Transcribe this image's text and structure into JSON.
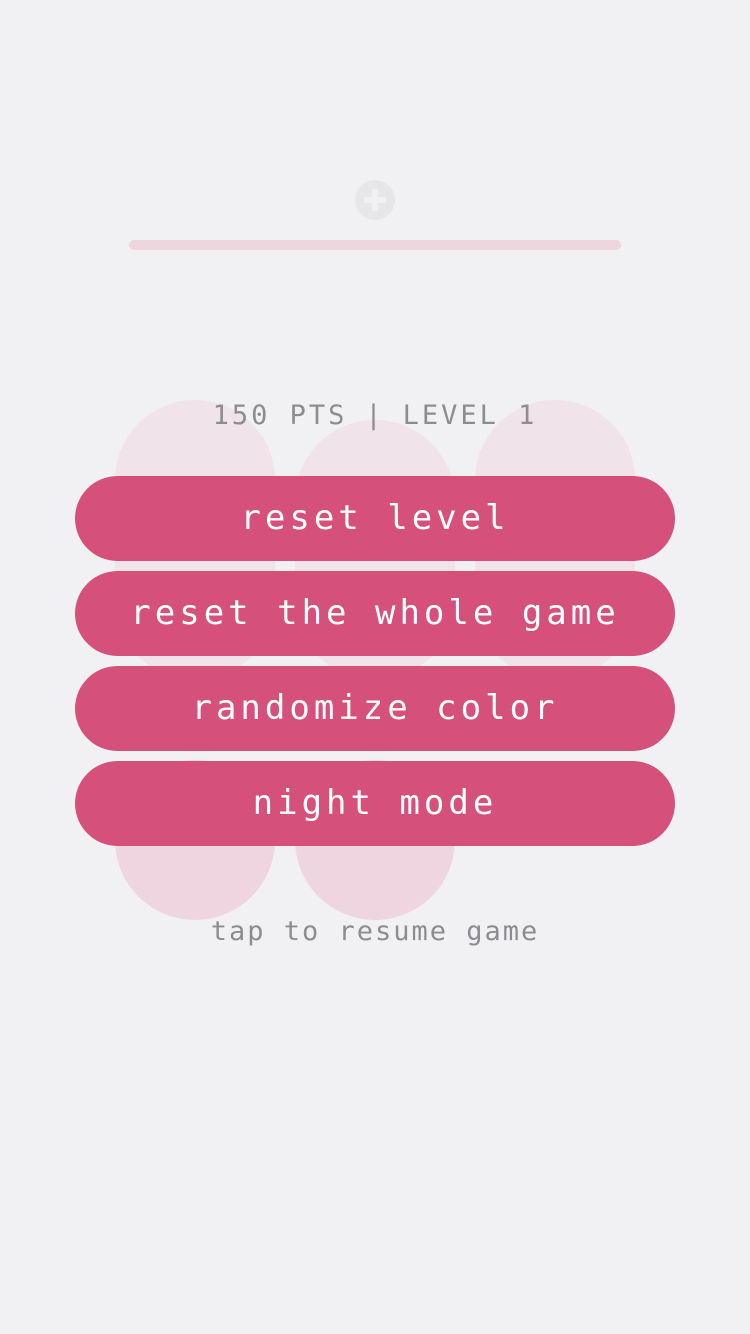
{
  "header": {
    "icon": "plus-circle-icon",
    "progress_fraction": 1.0
  },
  "score": {
    "points": "150 PTS",
    "separator": "|",
    "level": "LEVEL 1"
  },
  "menu": {
    "reset_level": "reset level",
    "reset_game": "reset the whole game",
    "randomize_color": "randomize color",
    "night_mode": "night mode"
  },
  "hint": "tap to resume game",
  "colors": {
    "background": "#f1f0f2",
    "button": "#d5517c",
    "button_text": "#ffffff",
    "muted_text": "#8e8c91",
    "pill_light": "#f0e3ea",
    "pill_dark": "#efd5df"
  }
}
